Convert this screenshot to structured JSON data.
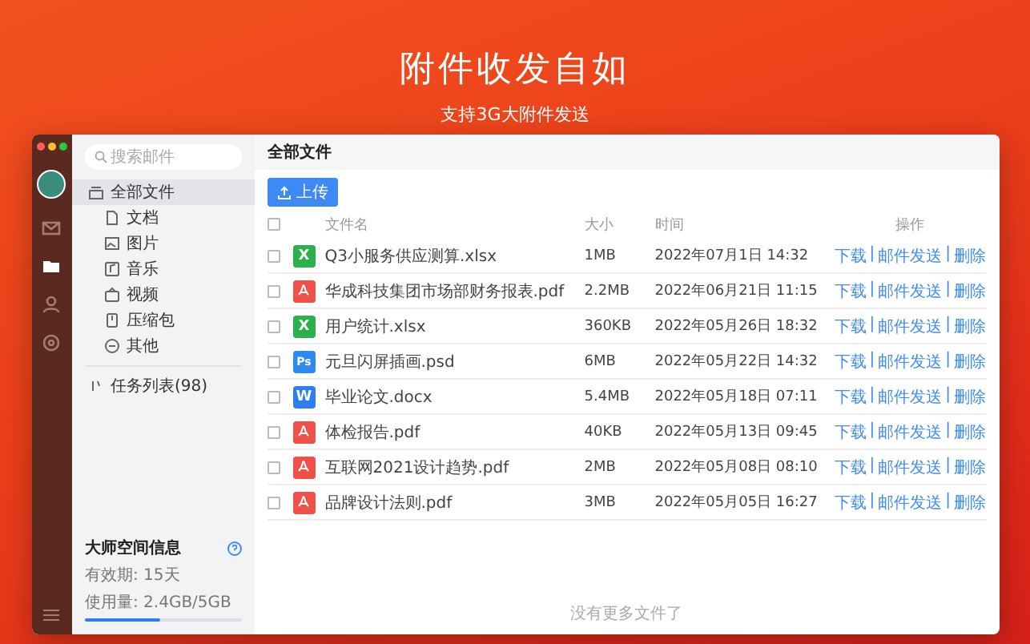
{
  "hero": {
    "title": "附件收发自如",
    "subtitle": "支持3G大附件发送"
  },
  "rail": {
    "items": [
      {
        "kind": "mail",
        "selected": false
      },
      {
        "kind": "folder",
        "selected": true
      },
      {
        "kind": "contacts",
        "selected": false
      },
      {
        "kind": "settings",
        "selected": false
      }
    ]
  },
  "sidebar": {
    "search": {
      "placeholder": "搜索邮件"
    },
    "items": [
      {
        "label": "全部文件",
        "kind": "all",
        "selected": true,
        "children": [
          {
            "label": "文档",
            "kind": "doc",
            "selected": false
          },
          {
            "label": "图片",
            "kind": "image",
            "selected": false
          },
          {
            "label": "音乐",
            "kind": "music",
            "selected": false
          },
          {
            "label": "视频",
            "kind": "video",
            "selected": false
          },
          {
            "label": "压缩包",
            "kind": "zip",
            "selected": false
          },
          {
            "label": "其他",
            "kind": "other",
            "selected": false
          }
        ]
      },
      {
        "label": "任务列表(98)",
        "kind": "tasks",
        "selected": false
      }
    ],
    "storage": {
      "title": "大师空间信息",
      "validity": "有效期: 15天",
      "usage": "使用量: 2.4GB/5GB",
      "level": 0.48
    }
  },
  "main": {
    "title": "全部文件",
    "upload_button": "上传",
    "table": {
      "columns": [
        "文件名",
        "大小",
        "时间",
        "操作"
      ],
      "all_checked": false,
      "action_separator": "|",
      "rows": [
        {
          "name": "Q3小服务供应测算.xlsx",
          "kind": "excel",
          "icon_text": "X",
          "size": "1MB",
          "time": "2022年07月1日 14:32",
          "checked": false,
          "actions": [
            "下载",
            "邮件发送",
            "删除"
          ]
        },
        {
          "name": "华成科技集团市场部财务报表.pdf",
          "kind": "pdf",
          "size": "2.2MB",
          "time": "2022年06月21日 11:15",
          "checked": false,
          "actions": [
            "下载",
            "邮件发送",
            "删除"
          ]
        },
        {
          "name": "用户统计.xlsx",
          "kind": "excel",
          "icon_text": "X",
          "size": "360KB",
          "time": "2022年05月26日 18:32",
          "checked": false,
          "actions": [
            "下载",
            "邮件发送",
            "删除"
          ]
        },
        {
          "name": "元旦闪屏插画.psd",
          "kind": "psd",
          "icon_text": "Ps",
          "size": "6MB",
          "time": "2022年05月22日 14:32",
          "checked": false,
          "actions": [
            "下载",
            "邮件发送",
            "删除"
          ]
        },
        {
          "name": "毕业论文.docx",
          "kind": "word",
          "icon_text": "W",
          "size": "5.4MB",
          "time": "2022年05月18日 07:11",
          "checked": false,
          "actions": [
            "下载",
            "邮件发送",
            "删除"
          ]
        },
        {
          "name": "体检报告.pdf",
          "kind": "pdf",
          "size": "40KB",
          "time": "2022年05月13日 09:45",
          "checked": false,
          "actions": [
            "下载",
            "邮件发送",
            "删除"
          ]
        },
        {
          "name": "互联网2021设计趋势.pdf",
          "kind": "pdf",
          "size": "2MB",
          "time": "2022年05月08日 08:10",
          "checked": false,
          "actions": [
            "下载",
            "邮件发送",
            "删除"
          ]
        },
        {
          "name": "品牌设计法则.pdf",
          "kind": "pdf",
          "size": "3MB",
          "time": "2022年05月05日 16:27",
          "checked": false,
          "actions": [
            "下载",
            "邮件发送",
            "删除"
          ]
        }
      ]
    },
    "footer": "没有更多文件了"
  }
}
